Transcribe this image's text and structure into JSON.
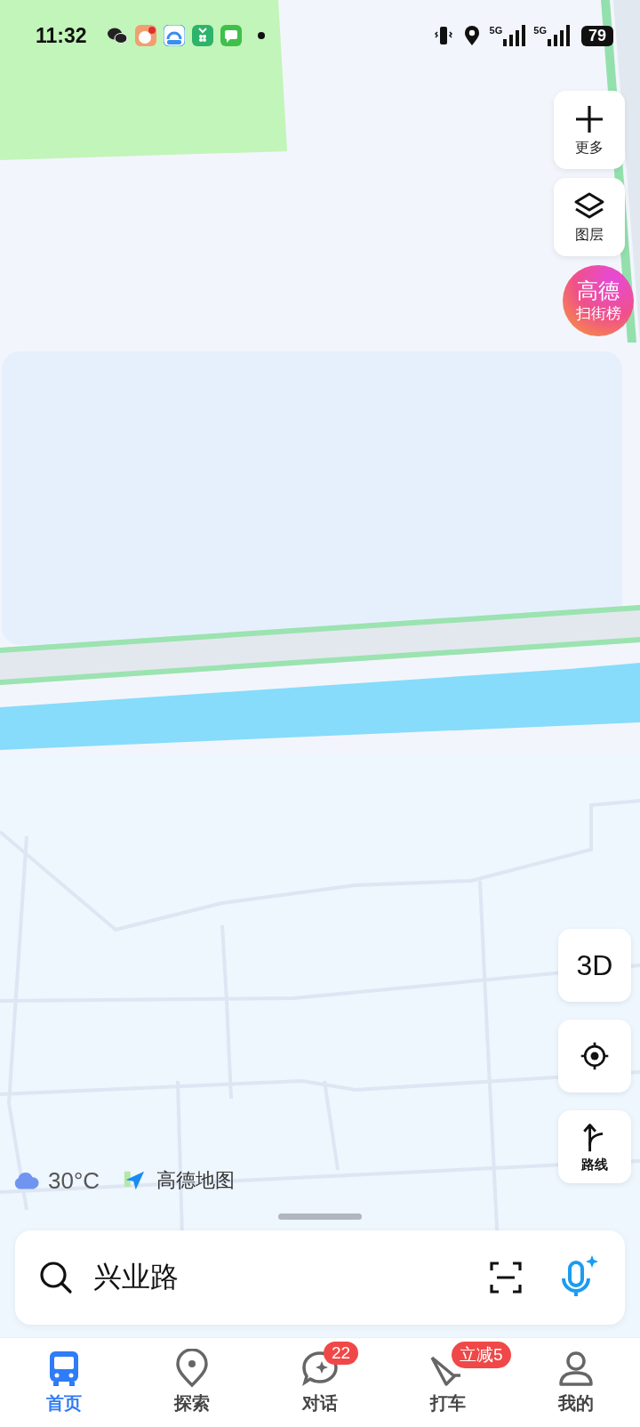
{
  "status_bar": {
    "time": "11:32",
    "battery": "79",
    "networks": [
      "5G",
      "5G"
    ]
  },
  "map_controls": [
    {
      "kind": "plus",
      "label": "更多"
    },
    {
      "kind": "layers",
      "label": "图层"
    }
  ],
  "ranking_badge": {
    "title": "高德",
    "subtitle": "扫街榜"
  },
  "view_controls": [
    {
      "kind": "text",
      "label": "3D"
    },
    {
      "kind": "locate"
    },
    {
      "kind": "route",
      "label": "路线"
    }
  ],
  "weather": {
    "temperature": "30°C"
  },
  "brand": "高德地图",
  "search": {
    "value": "兴业路"
  },
  "nav": [
    {
      "kind": "bus",
      "label": "首页",
      "selected": true
    },
    {
      "kind": "pin",
      "label": "探索",
      "selected": false
    },
    {
      "kind": "chat",
      "label": "对话",
      "selected": false,
      "badge": "22"
    },
    {
      "kind": "taxi",
      "label": "打车",
      "selected": false,
      "badge": "立减5"
    },
    {
      "kind": "person",
      "label": "我的",
      "selected": false
    }
  ]
}
